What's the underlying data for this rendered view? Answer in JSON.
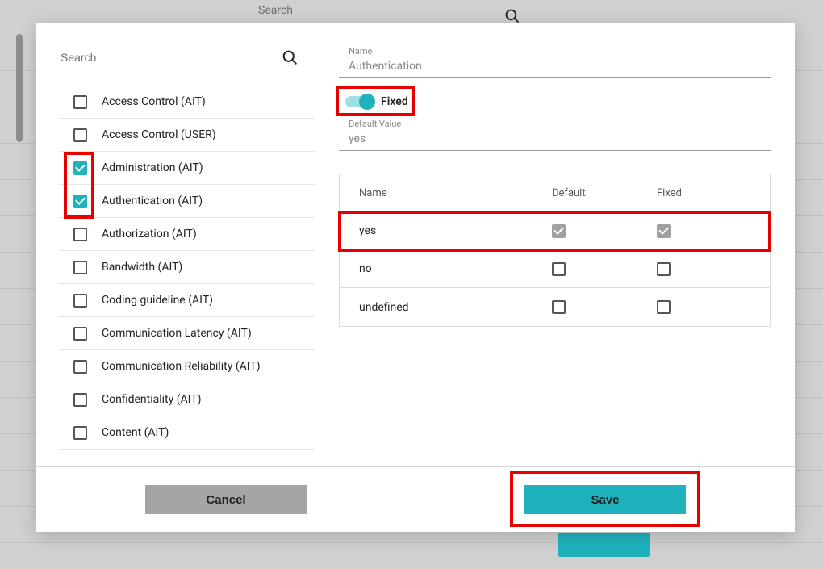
{
  "bg": {
    "search_placeholder": "Search"
  },
  "modal": {
    "left": {
      "search_placeholder": "Search",
      "items": [
        {
          "label": "Access Control (AIT)",
          "checked": false
        },
        {
          "label": "Access Control (USER)",
          "checked": false
        },
        {
          "label": "Administration (AIT)",
          "checked": true
        },
        {
          "label": "Authentication (AIT)",
          "checked": true
        },
        {
          "label": "Authorization (AIT)",
          "checked": false
        },
        {
          "label": "Bandwidth (AIT)",
          "checked": false
        },
        {
          "label": "Coding guideline (AIT)",
          "checked": false
        },
        {
          "label": "Communication Latency (AIT)",
          "checked": false
        },
        {
          "label": "Communication Reliability (AIT)",
          "checked": false
        },
        {
          "label": "Confidentiality (AIT)",
          "checked": false
        },
        {
          "label": "Content (AIT)",
          "checked": false
        }
      ]
    },
    "right": {
      "name_label": "Name",
      "name_value": "Authentication",
      "fixed_label": "Fixed",
      "fixed_on": true,
      "default_value_label": "Default Value",
      "default_value": "yes",
      "table": {
        "headers": {
          "name": "Name",
          "default": "Default",
          "fixed": "Fixed"
        },
        "rows": [
          {
            "name": "yes",
            "default": "grey-checked",
            "fixed": "grey-checked",
            "highlight": true
          },
          {
            "name": "no",
            "default": "unchecked",
            "fixed": "unchecked",
            "highlight": false
          },
          {
            "name": "undefined",
            "default": "unchecked",
            "fixed": "unchecked",
            "highlight": false
          }
        ]
      }
    },
    "footer": {
      "cancel": "Cancel",
      "save": "Save"
    }
  },
  "highlights": {
    "checked_items_box": true,
    "fixed_toggle_box": true,
    "yes_row_box": true,
    "save_box": true
  }
}
